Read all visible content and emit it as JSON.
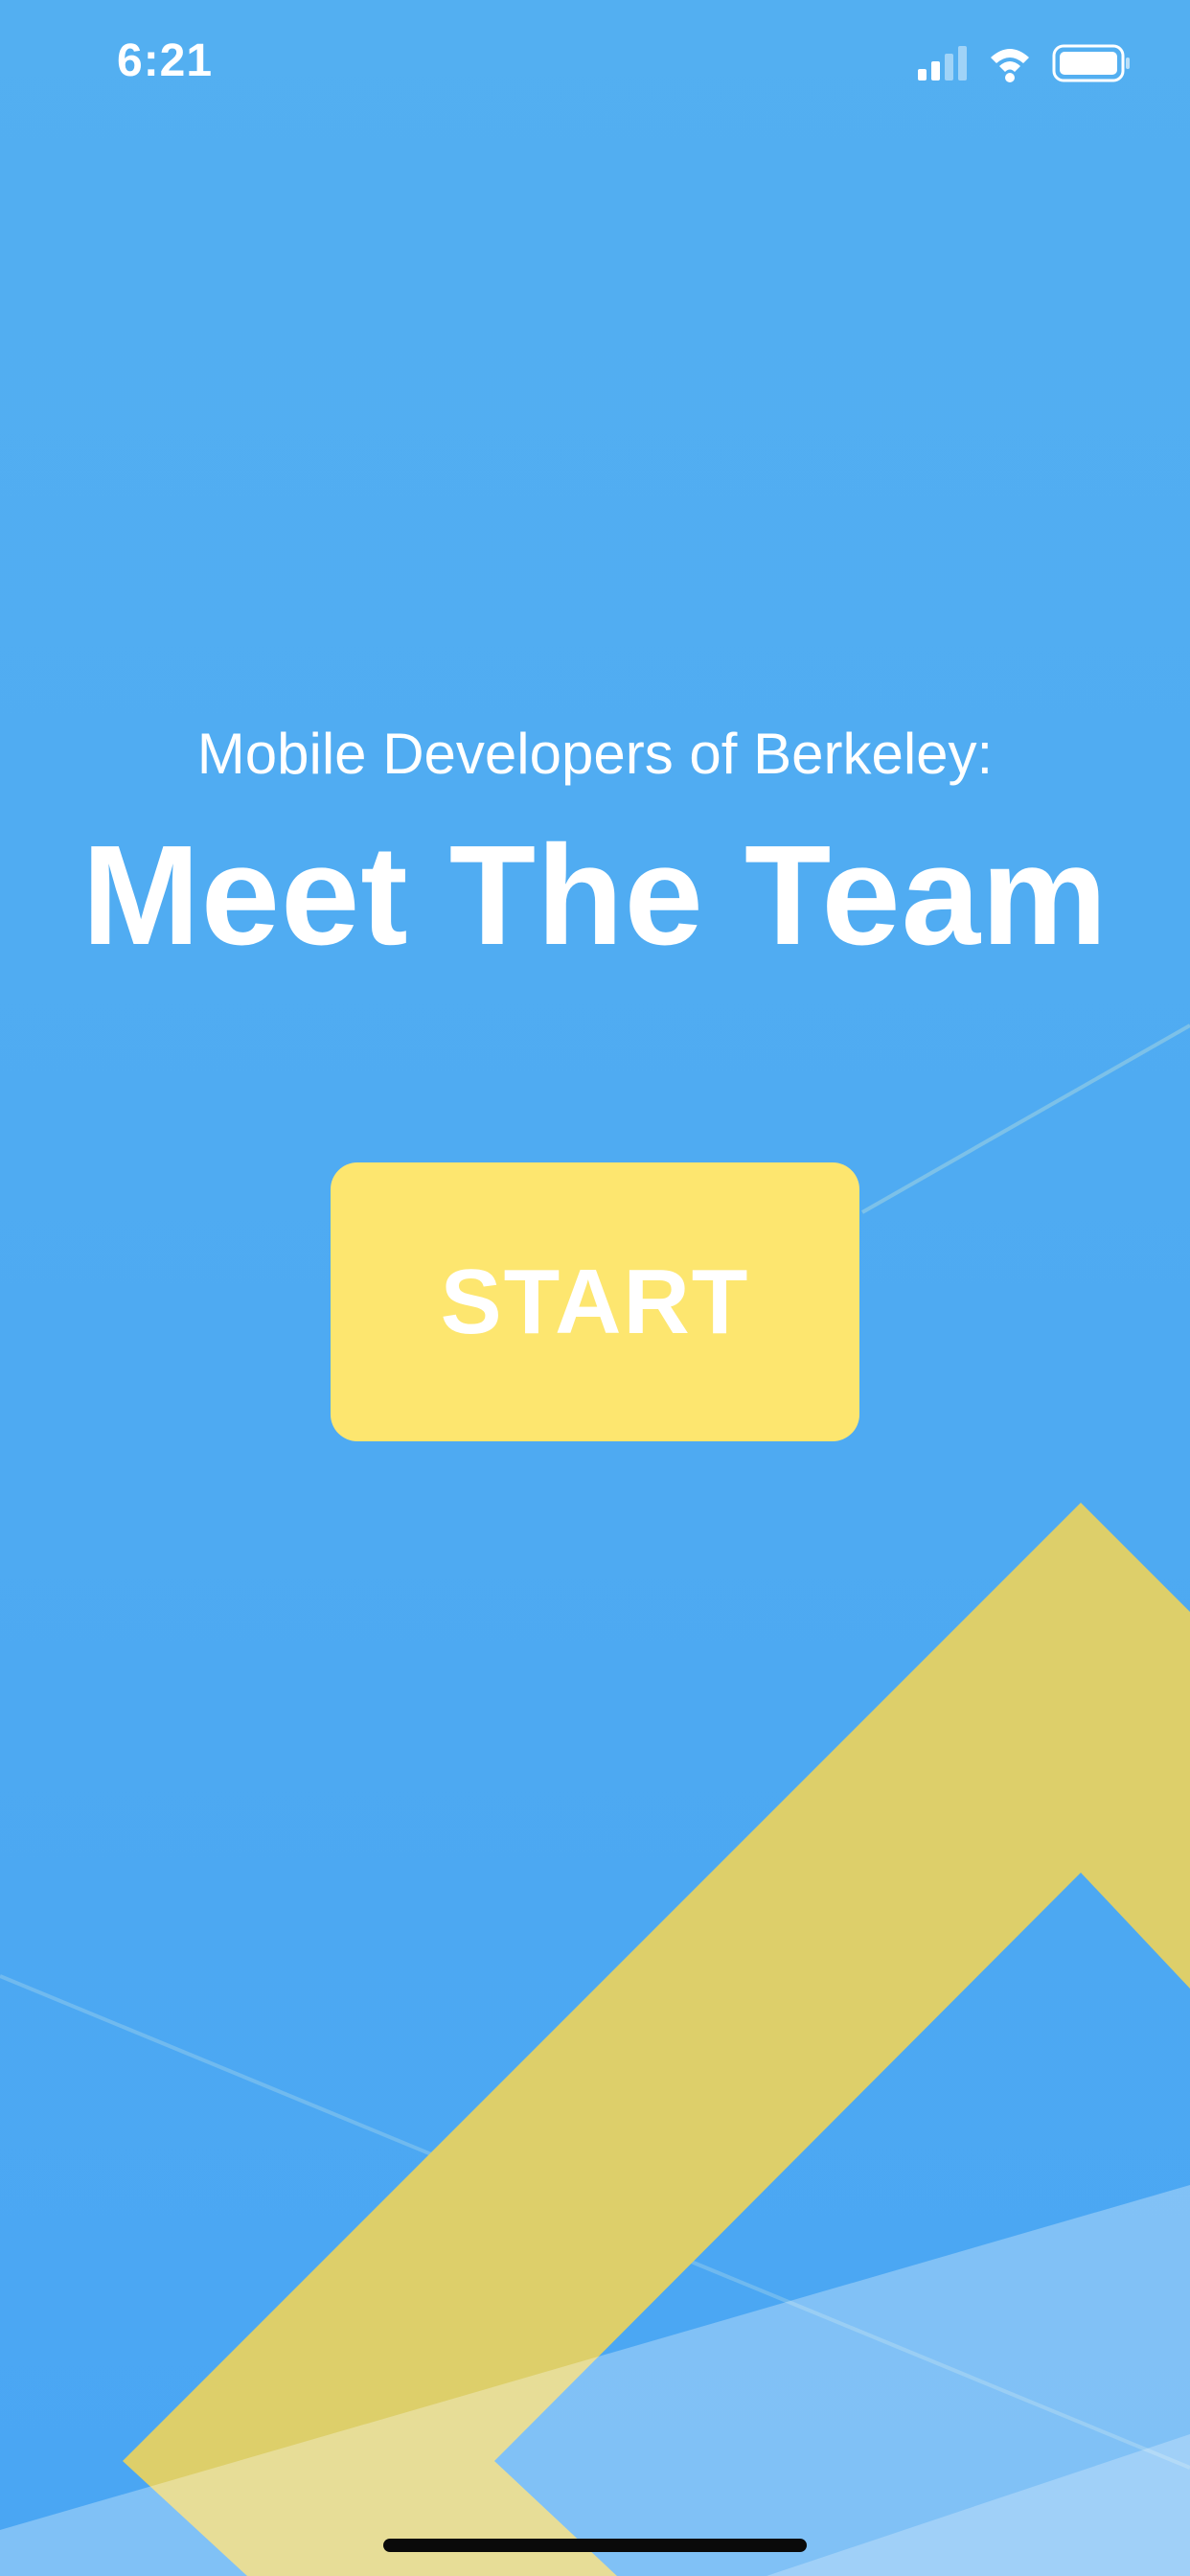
{
  "status_bar": {
    "time": "6:21",
    "icons": [
      "cellular-signal-icon",
      "wifi-icon",
      "battery-icon"
    ]
  },
  "hero": {
    "subtitle": "Mobile Developers of Berkeley:",
    "title": "Meet The Team"
  },
  "start_button": {
    "label": "START"
  },
  "colors": {
    "background": "#52adf2",
    "accent_yellow": "#fde66f",
    "shape_yellow": "#ddcf6a",
    "text": "#ffffff"
  }
}
